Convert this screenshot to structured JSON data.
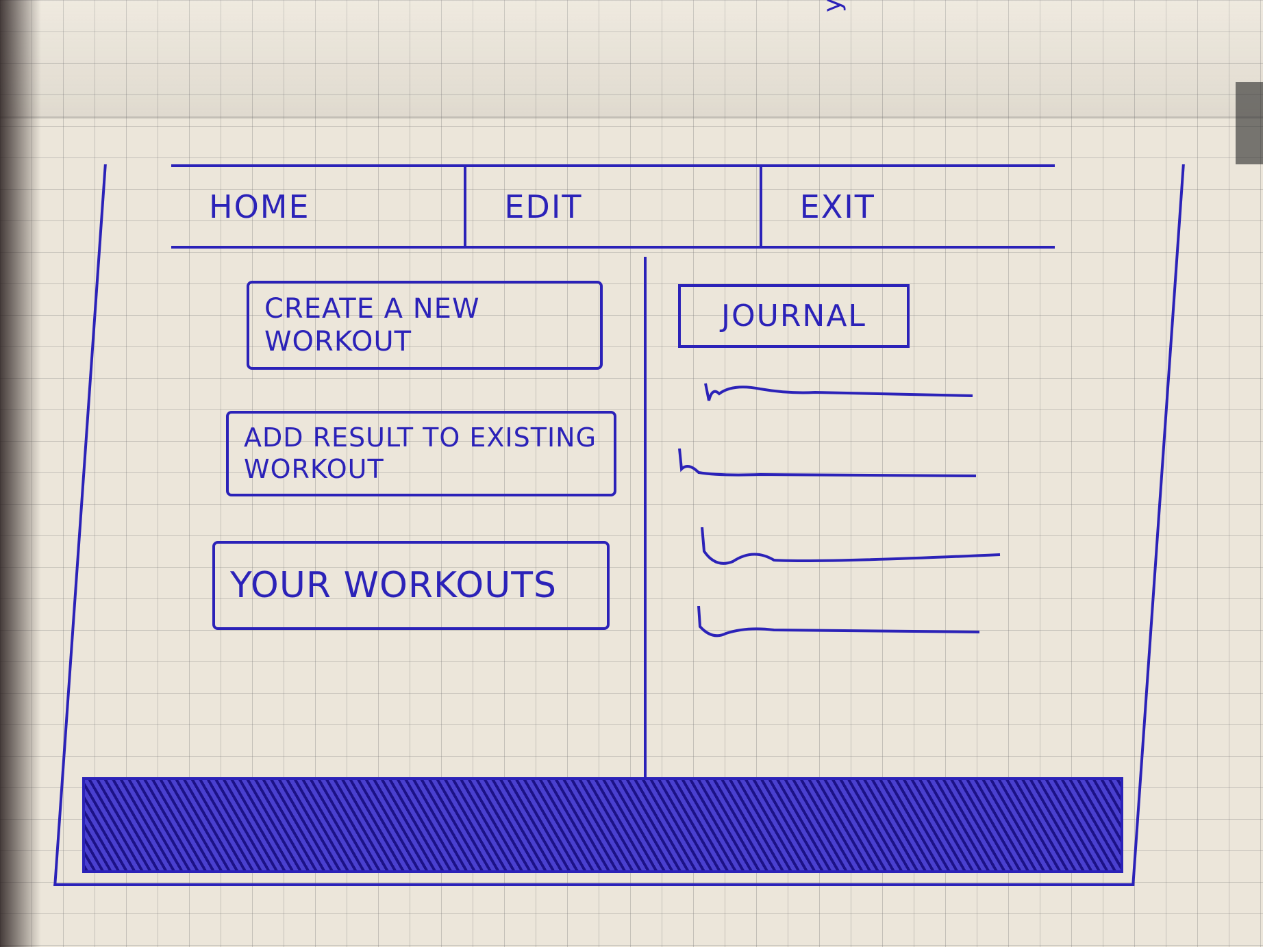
{
  "colors": {
    "ink": "#2b22b8",
    "paper": "#ece6da"
  },
  "nav": {
    "items": [
      {
        "label": "HOME"
      },
      {
        "label": "EDIT"
      },
      {
        "label": "EXIT"
      }
    ]
  },
  "main": {
    "create_button": "CREATE A NEW WORKOUT",
    "add_result_button": "ADD RESULT TO EXISTING WORKOUT",
    "your_workouts_button": "YOUR WORKOUTS"
  },
  "sidebar": {
    "journal_label": "JOURNAL",
    "entry_count_visible": 4
  },
  "corner_note": "ygg"
}
